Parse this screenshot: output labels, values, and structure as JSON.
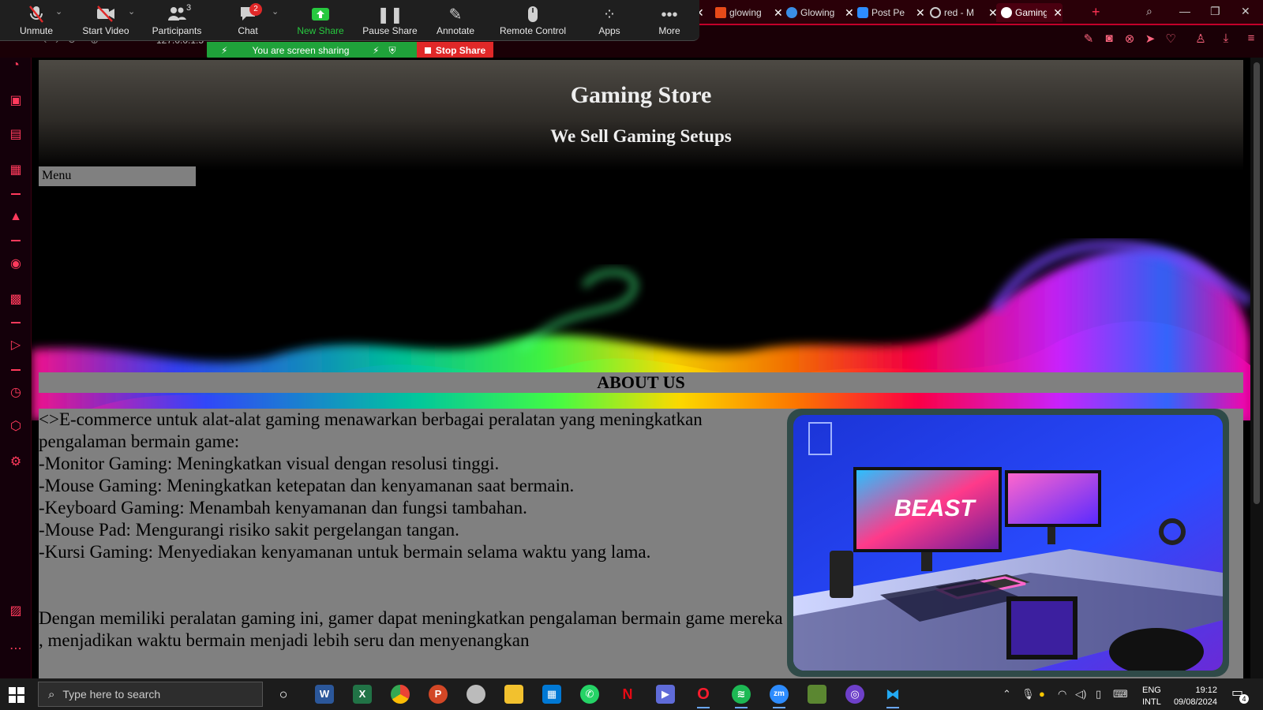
{
  "zoom": {
    "buttons": [
      {
        "label": "Unmute",
        "icon": "mic-off-icon"
      },
      {
        "label": "Start Video",
        "icon": "video-off-icon"
      },
      {
        "label": "Participants",
        "icon": "participants-icon"
      },
      {
        "label": "Chat",
        "icon": "chat-icon"
      },
      {
        "label": "New Share",
        "icon": "share-icon"
      },
      {
        "label": "Pause Share",
        "icon": "pause-icon"
      },
      {
        "label": "Annotate",
        "icon": "pen-icon"
      },
      {
        "label": "Remote Control",
        "icon": "mouse-icon"
      },
      {
        "label": "Apps",
        "icon": "apps-icon"
      },
      {
        "label": "More",
        "icon": "more-icon"
      }
    ],
    "participants_count": "3",
    "chat_badge": "2",
    "share_banner": "You are screen sharing",
    "stop_share": "Stop Share"
  },
  "browser": {
    "tabs": [
      {
        "title": "glowing",
        "active": false
      },
      {
        "title": "Glowing",
        "active": false
      },
      {
        "title": "Post Pe",
        "active": false
      },
      {
        "title": "red - M",
        "active": false
      },
      {
        "title": "Gaming",
        "active": true
      }
    ],
    "url_fragment": "127.0.0.1:5",
    "accent": "#ff3a5c"
  },
  "site": {
    "title": "Gaming Store",
    "subtitle": "We Sell Gaming Setups",
    "menu_label": "Menu",
    "about_heading": "ABOUT US",
    "about_lines": [
      "<>E-commerce untuk alat-alat gaming menawarkan berbagai peralatan yang meningkatkan pengalaman bermain game:",
      "-Monitor Gaming: Meningkatkan visual dengan resolusi tinggi.",
      "-Mouse Gaming: Meningkatkan ketepatan dan kenyamanan saat bermain.",
      "-Keyboard Gaming: Menambah kenyamanan dan fungsi tambahan.",
      "-Mouse Pad: Mengurangi risiko sakit pergelangan tangan.",
      "-Kursi Gaming: Menyediakan kenyamanan untuk bermain selama waktu yang lama."
    ],
    "about_closing": [
      "Dengan memiliki peralatan gaming ini, gamer dapat meningkatkan pengalaman bermain game mereka",
      ", menjadikan waktu bermain menjadi lebih seru dan menyenangkan"
    ],
    "photo_text": "BEAST"
  },
  "taskbar": {
    "search_placeholder": "Type here to search",
    "language": "ENG",
    "layout": "INTL",
    "time": "19:12",
    "date": "09/08/2024",
    "notification_count": "4"
  }
}
